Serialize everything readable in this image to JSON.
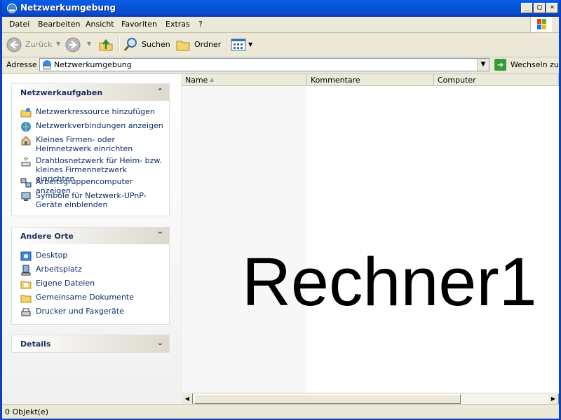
{
  "window": {
    "title": "Netzwerkumgebung"
  },
  "titlebar": {
    "minimize": "_",
    "maximize": "□",
    "close": "×"
  },
  "menu": [
    "Datei",
    "Bearbeiten",
    "Ansicht",
    "Favoriten",
    "Extras",
    "?"
  ],
  "toolbar": {
    "back_label": "Zurück",
    "search_label": "Suchen",
    "folders_label": "Ordner"
  },
  "address": {
    "label": "Adresse",
    "value": "Netzwerkumgebung",
    "go_label": "Wechseln zu"
  },
  "taskpane": {
    "network_tasks": {
      "title": "Netzwerkaufgaben",
      "items": [
        {
          "label": "Netzwerkressource hinzufügen",
          "icon": "add-network-place-icon"
        },
        {
          "label": "Netzwerkverbindungen anzeigen",
          "icon": "network-connections-icon"
        },
        {
          "label": "Kleines Firmen- oder Heimnetzwerk einrichten",
          "icon": "home-network-icon"
        },
        {
          "label": "Drahtlosnetzwerk für Heim- bzw. kleines Firmennetzwerk einrichten",
          "icon": "wireless-network-icon"
        },
        {
          "label": "Arbeitsgruppencomputer anzeigen",
          "icon": "workgroup-computers-icon"
        },
        {
          "label": "Symbole für Netzwerk-UPnP-Geräte einblenden",
          "icon": "upnp-devices-icon"
        }
      ]
    },
    "other_places": {
      "title": "Andere Orte",
      "items": [
        {
          "label": "Desktop",
          "icon": "desktop-icon"
        },
        {
          "label": "Arbeitsplatz",
          "icon": "my-computer-icon"
        },
        {
          "label": "Eigene Dateien",
          "icon": "my-documents-icon"
        },
        {
          "label": "Gemeinsame Dokumente",
          "icon": "shared-documents-icon"
        },
        {
          "label": "Drucker und Faxgeräte",
          "icon": "printers-faxes-icon"
        }
      ]
    },
    "details": {
      "title": "Details"
    }
  },
  "list": {
    "columns": [
      "Name",
      "Kommentare",
      "Computer"
    ],
    "overlay_text": "Rechner1"
  },
  "statusbar": {
    "text": "0 Objekt(e)"
  }
}
